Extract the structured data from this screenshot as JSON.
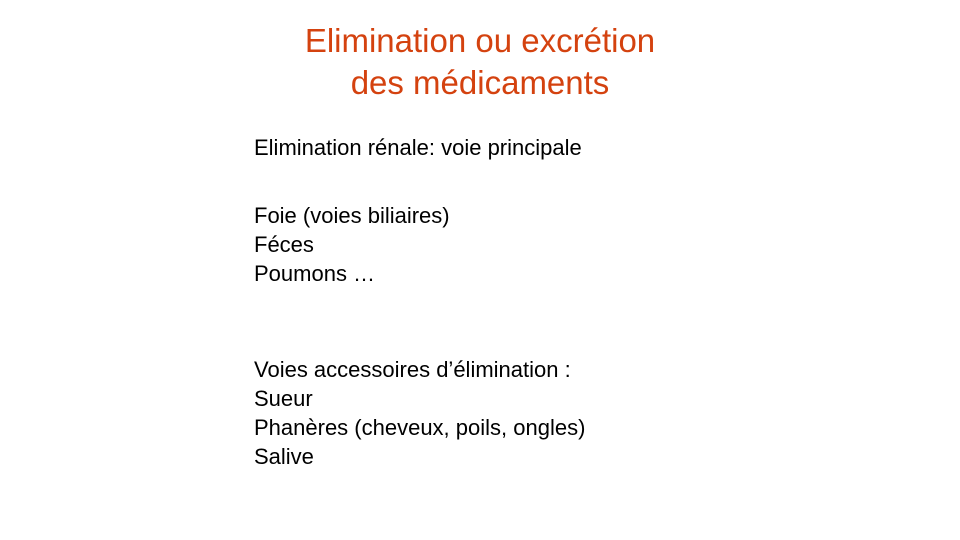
{
  "slide": {
    "title_lines": [
      "Elimination ou excrétion",
      "des médicaments"
    ],
    "primary": "Elimination rénale: voie principale",
    "group_one": [
      "Foie (voies biliaires)",
      "Féces",
      "Poumons …"
    ],
    "accessory_heading": "Voies accessoires d’élimination :",
    "accessory_items": [
      "Sueur",
      "Phanères (cheveux, poils, ongles)",
      "Salive"
    ]
  },
  "colors": {
    "title": "#d4420f",
    "text": "#000000",
    "background": "#ffffff"
  }
}
